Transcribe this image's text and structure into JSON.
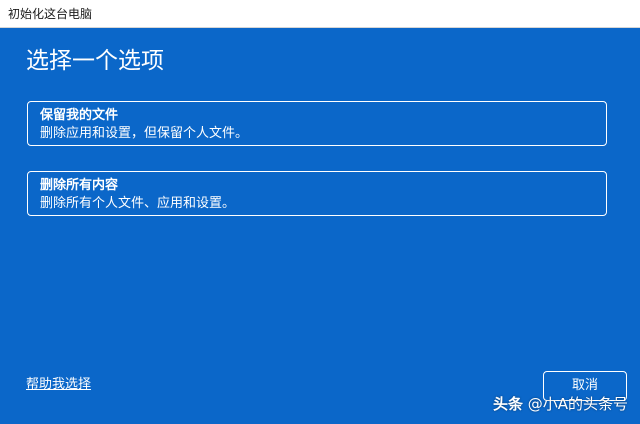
{
  "window": {
    "title": "初始化这台电脑"
  },
  "main": {
    "heading": "选择一个选项",
    "options": [
      {
        "title": "保留我的文件",
        "description": "删除应用和设置，但保留个人文件。"
      },
      {
        "title": "删除所有内容",
        "description": "删除所有个人文件、应用和设置。"
      }
    ]
  },
  "footer": {
    "help_link": "帮助我选择",
    "cancel_label": "取消"
  },
  "watermark": {
    "brand": "头条",
    "handle": "@小A的头条号"
  },
  "colors": {
    "background": "#0b67c9",
    "titlebar": "#ffffff",
    "text": "#ffffff"
  }
}
